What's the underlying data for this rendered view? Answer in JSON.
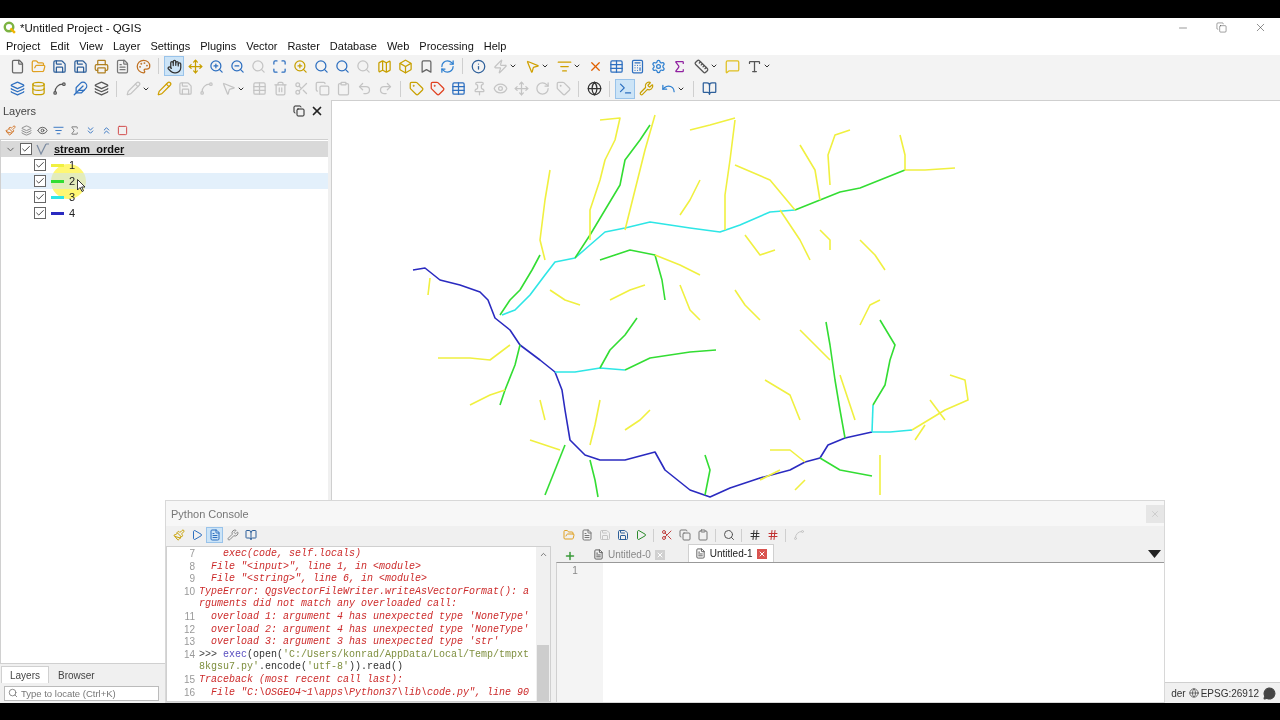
{
  "window": {
    "title": "*Untitled Project - QGIS"
  },
  "menu": [
    "Project",
    "Edit",
    "View",
    "Layer",
    "Settings",
    "Plugins",
    "Vector",
    "Raster",
    "Database",
    "Web",
    "Processing",
    "Help"
  ],
  "toolbar_rows": [
    {
      "buttons": [
        {
          "selected": false,
          "disabled": false
        },
        {
          "selected": false,
          "disabled": false
        },
        {
          "selected": false,
          "disabled": false
        },
        {
          "selected": false,
          "disabled": false
        },
        {
          "selected": false,
          "disabled": false
        },
        {
          "selected": false,
          "disabled": false
        },
        {
          "selected": false,
          "disabled": false
        },
        {
          "selected": true,
          "disabled": false
        },
        {
          "selected": false,
          "disabled": false
        },
        {
          "selected": false,
          "disabled": false
        },
        {
          "selected": false,
          "disabled": false
        },
        {
          "selected": false,
          "disabled": true
        },
        {
          "selected": false,
          "disabled": false
        },
        {
          "selected": false,
          "disabled": false
        },
        {
          "selected": false,
          "disabled": false
        },
        {
          "selected": false,
          "disabled": false
        },
        {
          "selected": false,
          "disabled": true
        },
        {
          "selected": false,
          "disabled": false
        },
        {
          "selected": false,
          "disabled": false
        },
        {
          "selected": false,
          "disabled": false
        },
        {
          "selected": false,
          "disabled": false
        },
        {
          "selected": false,
          "disabled": false
        },
        {
          "selected": false,
          "disabled": true
        },
        {
          "selected": false,
          "disabled": false
        },
        {
          "selected": false,
          "disabled": false
        },
        {
          "selected": false,
          "disabled": false
        },
        {
          "selected": false,
          "disabled": false
        },
        {
          "selected": false,
          "disabled": false
        },
        {
          "selected": false,
          "disabled": false
        },
        {
          "selected": false,
          "disabled": false
        },
        {
          "selected": false,
          "disabled": false
        },
        {
          "selected": false,
          "disabled": false
        },
        {
          "selected": false,
          "disabled": false
        }
      ]
    },
    {
      "buttons": [
        {
          "selected": false,
          "disabled": false
        },
        {
          "selected": false,
          "disabled": false
        },
        {
          "selected": false,
          "disabled": false
        },
        {
          "selected": false,
          "disabled": false
        },
        {
          "selected": false,
          "disabled": false
        },
        {
          "selected": false,
          "disabled": true
        },
        {
          "selected": false,
          "disabled": false
        },
        {
          "selected": false,
          "disabled": true
        },
        {
          "selected": false,
          "disabled": true
        },
        {
          "selected": false,
          "disabled": true
        },
        {
          "selected": false,
          "disabled": true
        },
        {
          "selected": false,
          "disabled": true
        },
        {
          "selected": false,
          "disabled": true
        },
        {
          "selected": false,
          "disabled": true
        },
        {
          "selected": false,
          "disabled": true
        },
        {
          "selected": false,
          "disabled": true
        },
        {
          "selected": false,
          "disabled": true
        },
        {
          "selected": false,
          "disabled": false
        },
        {
          "selected": false,
          "disabled": false
        },
        {
          "selected": false,
          "disabled": false
        },
        {
          "selected": false,
          "disabled": true
        },
        {
          "selected": false,
          "disabled": true
        },
        {
          "selected": false,
          "disabled": true
        },
        {
          "selected": false,
          "disabled": true
        },
        {
          "selected": false,
          "disabled": true
        },
        {
          "selected": false,
          "disabled": false
        },
        {
          "selected": true,
          "disabled": false
        },
        {
          "selected": false,
          "disabled": false
        },
        {
          "selected": false,
          "disabled": false
        },
        {
          "selected": false,
          "disabled": false
        }
      ]
    }
  ],
  "layers_panel": {
    "title": "Layers",
    "tree": [
      {
        "label": "stream_order",
        "checked": true,
        "expanded": true,
        "selected": true,
        "children": [
          {
            "label": "1",
            "checked": true,
            "hovered": false,
            "color": "#f0f040"
          },
          {
            "label": "2",
            "checked": true,
            "hovered": true,
            "color": "#33dd33"
          },
          {
            "label": "3",
            "checked": true,
            "hovered": false,
            "color": "#2ee6e6"
          },
          {
            "label": "4",
            "checked": true,
            "hovered": false,
            "color": "#2a2ac0"
          }
        ]
      }
    ],
    "tabs": [
      {
        "label": "Layers",
        "selected": true
      },
      {
        "label": "Browser",
        "selected": false
      }
    ],
    "locate": {
      "placeholder": "Type to locate (Ctrl+K)"
    }
  },
  "python_console": {
    "title": "Python Console",
    "toolbar": [
      {
        "selected": false,
        "disabled": false
      },
      {
        "selected": false,
        "disabled": false
      },
      {
        "selected": true,
        "disabled": false
      },
      {
        "selected": false,
        "disabled": false
      },
      {
        "selected": false,
        "disabled": false
      }
    ],
    "lines": [
      {
        "number": "7",
        "segments": [
          {
            "kind": "error",
            "text": "    exec(code, self.locals)"
          }
        ]
      },
      {
        "number": "8",
        "segments": [
          {
            "kind": "error",
            "text": "  File \"<input>\", line 1, in <module>"
          }
        ]
      },
      {
        "number": "9",
        "segments": [
          {
            "kind": "error",
            "text": "  File \"<string>\", line 6, in <module>"
          }
        ]
      },
      {
        "number": "10",
        "segments": [
          {
            "kind": "error",
            "text": "TypeError: QgsVectorFileWriter.writeAsVectorFormat(): arguments did not match any overloaded call:"
          }
        ]
      },
      {
        "number": "11",
        "segments": [
          {
            "kind": "error",
            "text": "  overload 1: argument 4 has unexpected type 'NoneType'"
          }
        ]
      },
      {
        "number": "12",
        "segments": [
          {
            "kind": "error",
            "text": "  overload 2: argument 4 has unexpected type 'NoneType'"
          }
        ]
      },
      {
        "number": "13",
        "segments": [
          {
            "kind": "error",
            "text": "  overload 3: argument 3 has unexpected type 'str'"
          }
        ]
      },
      {
        "number": "14",
        "segments": [
          {
            "kind": "prompt",
            "text": ">>> "
          },
          {
            "kind": "builtin",
            "text": "exec"
          },
          {
            "kind": "plain",
            "text": "(open("
          },
          {
            "kind": "string",
            "text": "'C:/Users/konrad/AppData/Local/Temp/tmpxt8kgsu7.py'"
          },
          {
            "kind": "plain",
            "text": ".encode("
          },
          {
            "kind": "string",
            "text": "'utf-8'"
          },
          {
            "kind": "plain",
            "text": ")).read()"
          }
        ]
      },
      {
        "number": "15",
        "segments": [
          {
            "kind": "error",
            "text": "Traceback (most recent call last):"
          }
        ]
      },
      {
        "number": "16",
        "segments": [
          {
            "kind": "error",
            "text": "  File \"C:\\OSGEO4~1\\apps\\Python37\\lib\\code.py\", line 90"
          }
        ]
      }
    ],
    "editor": {
      "toolbar": [
        {
          "selected": false,
          "disabled": false
        },
        {
          "selected": false,
          "disabled": false
        },
        {
          "selected": false,
          "disabled": true
        },
        {
          "selected": false,
          "disabled": false
        },
        {
          "selected": false,
          "disabled": false
        },
        {
          "selected": false,
          "disabled": false
        },
        {
          "selected": false,
          "disabled": false
        },
        {
          "selected": false,
          "disabled": false
        },
        {
          "selected": false,
          "disabled": false
        },
        {
          "selected": false,
          "disabled": false
        },
        {
          "selected": false,
          "disabled": false
        },
        {
          "selected": false,
          "disabled": true
        }
      ],
      "tabs": [
        {
          "label": "Untitled-0",
          "selected": false
        },
        {
          "label": "Untitled-1",
          "selected": true
        }
      ],
      "line_numbers": [
        "1"
      ]
    }
  },
  "status_bar": {
    "render": "der",
    "crs": "EPSG:26912"
  }
}
